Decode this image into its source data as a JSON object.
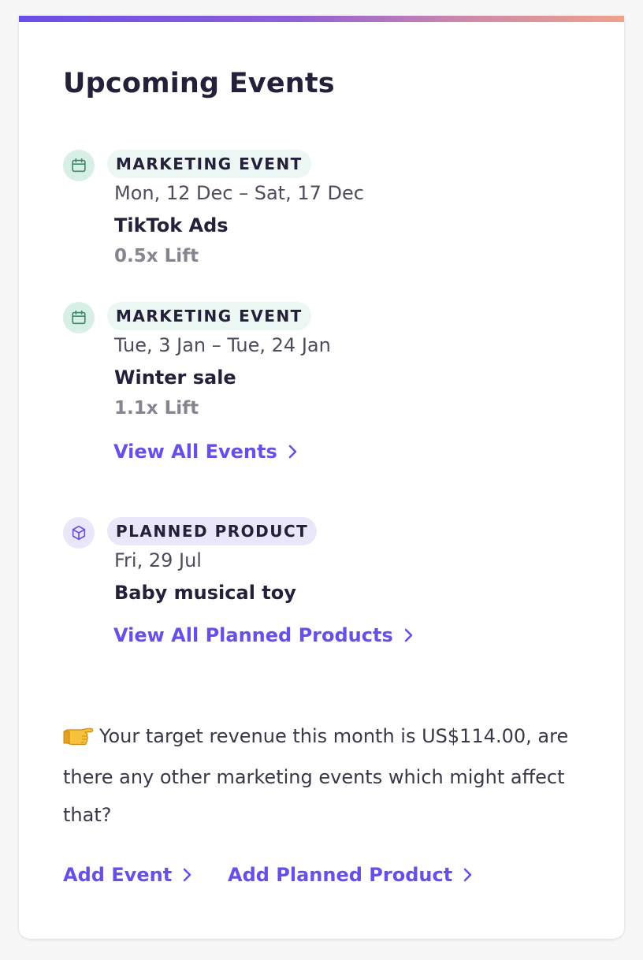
{
  "card": {
    "title": "Upcoming Events",
    "accent_color": "#6a4ee8"
  },
  "events": [
    {
      "badge": "MARKETING EVENT",
      "icon": "calendar-icon",
      "dates": "Mon, 12 Dec – Sat, 17 Dec",
      "name": "TikTok Ads",
      "lift": "0.5x Lift"
    },
    {
      "badge": "MARKETING EVENT",
      "icon": "calendar-icon",
      "dates": "Tue, 3 Jan – Tue, 24 Jan",
      "name": "Winter sale",
      "lift": "1.1x Lift"
    }
  ],
  "view_all_events": "View All Events",
  "planned_products": [
    {
      "badge": "PLANNED PRODUCT",
      "icon": "box-icon",
      "date": "Fri, 29 Jul",
      "name": "Baby musical toy"
    }
  ],
  "view_all_planned_products": "View All Planned Products",
  "message": {
    "emoji_icon": "pointing-hand-icon",
    "text": "Your target revenue this month is US$114.00, are there any other marketing events which might affect that?"
  },
  "actions": {
    "add_event": "Add Event",
    "add_planned_product": "Add Planned Product"
  }
}
